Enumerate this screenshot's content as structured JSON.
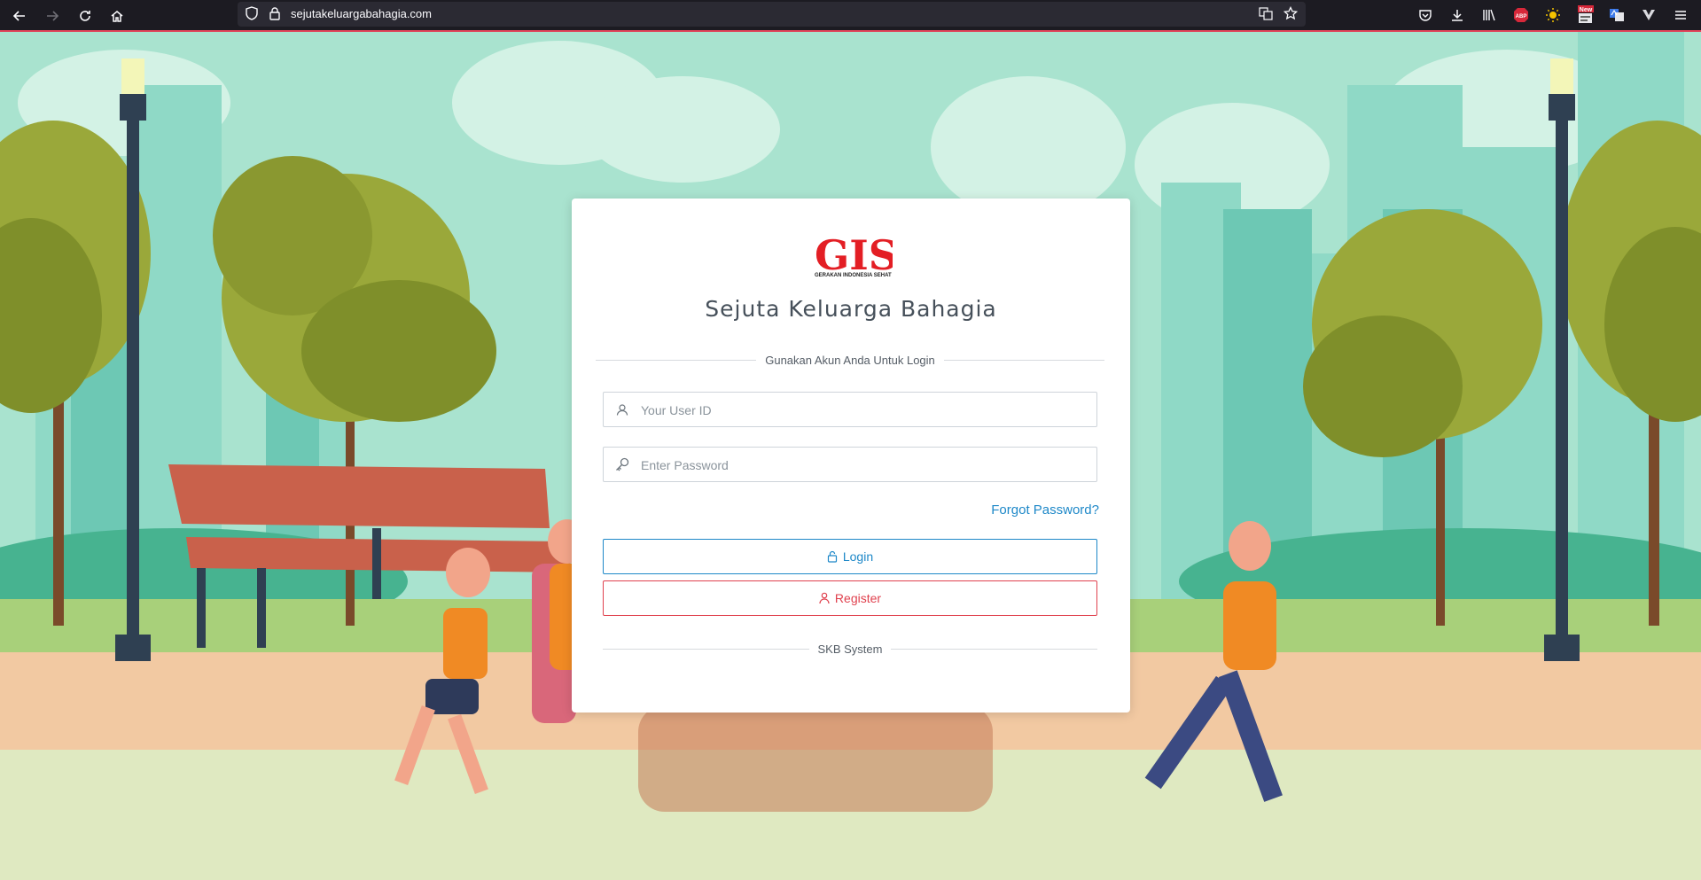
{
  "browser": {
    "url": "sejutakeluargabahagia.com",
    "icons": {
      "back": "back-arrow-icon",
      "forward": "forward-arrow-icon",
      "reload": "reload-icon",
      "home": "home-icon",
      "shield": "tracking-shield-icon",
      "lock": "lock-icon",
      "translate": "translate-icon",
      "bookmark": "star-bookmark-icon",
      "pocket": "pocket-icon",
      "downloads": "download-icon",
      "library": "library-icon",
      "abp": "adblock-plus-icon",
      "sun": "dark-reader-sun-icon",
      "news": "news-extension-icon",
      "translate_ext": "translate-extension-icon",
      "vpn": "vpn-extension-icon",
      "menu": "hamburger-menu-icon"
    },
    "abp_label": "ABP",
    "news_badge": "New"
  },
  "login": {
    "logo_text": "GIS",
    "logo_subtext": "GERAKAN INDONESIA SEHAT",
    "title": "Sejuta Keluarga Bahagia",
    "divider_label": "Gunakan Akun Anda Untuk Login",
    "user_placeholder": "Your User ID",
    "password_placeholder": "Enter Password",
    "forgot_label": "Forgot Password?",
    "login_label": "Login",
    "register_label": "Register",
    "footer_label": "SKB System"
  },
  "colors": {
    "accent_blue": "#1e88c8",
    "accent_red": "#e0414e",
    "logo_red": "#e31e24"
  }
}
